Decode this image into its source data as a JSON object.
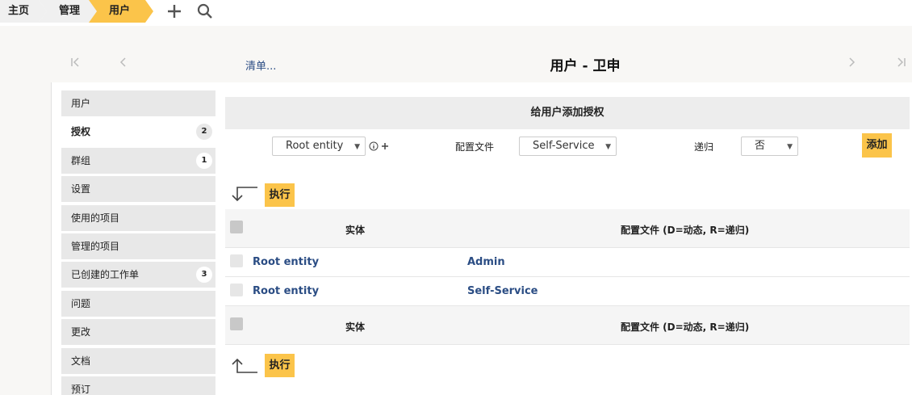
{
  "breadcrumb": {
    "home": "主页",
    "admin": "管理",
    "users": "用户"
  },
  "header": {
    "list_link": "清单...",
    "title": "用户 - 卫申"
  },
  "sidebar": {
    "items": [
      {
        "label": "用户",
        "badge": ""
      },
      {
        "label": "授权",
        "badge": "2"
      },
      {
        "label": "群组",
        "badge": "1"
      },
      {
        "label": "设置",
        "badge": ""
      },
      {
        "label": "使用的项目",
        "badge": ""
      },
      {
        "label": "管理的项目",
        "badge": ""
      },
      {
        "label": "已创建的工作单",
        "badge": "3"
      },
      {
        "label": "问题",
        "badge": ""
      },
      {
        "label": "更改",
        "badge": ""
      },
      {
        "label": "文档",
        "badge": ""
      },
      {
        "label": "预订",
        "badge": ""
      }
    ]
  },
  "form": {
    "title": "给用户添加授权",
    "entity_value": "Root entity",
    "profile_label": "配置文件",
    "profile_value": "Self-Service",
    "recursive_label": "递归",
    "recursive_value": "否",
    "add_label": "添加"
  },
  "actions": {
    "execute_label": "执行"
  },
  "table": {
    "col_entity": "实体",
    "col_profile": "配置文件 (D=动态, R=递归)",
    "rows": [
      {
        "entity": "Root entity",
        "profile": "Admin"
      },
      {
        "entity": "Root entity",
        "profile": "Self-Service"
      }
    ]
  },
  "colors": {
    "accent": "#fbc44a",
    "link": "#2b4d84"
  }
}
